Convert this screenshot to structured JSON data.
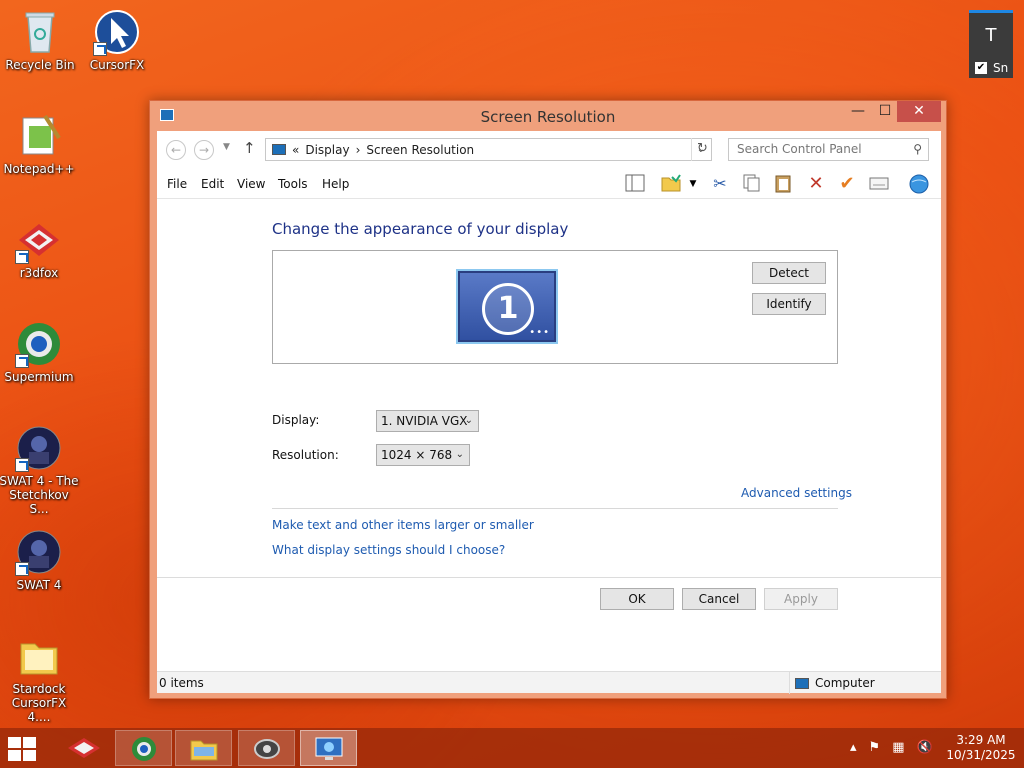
{
  "desktop": {
    "icons": [
      {
        "label": "Recycle Bin"
      },
      {
        "label": "CursorFX"
      },
      {
        "label": "Notepad++"
      },
      {
        "label": "r3dfox"
      },
      {
        "label": "Supermium"
      },
      {
        "label": "SWAT 4 - The Stetchkov S..."
      },
      {
        "label": "SWAT 4"
      },
      {
        "label": "Stardock CursorFX 4...."
      }
    ]
  },
  "gadget": {
    "title": "T",
    "checkbox_label": "Sn",
    "checkbox_mark": "✔"
  },
  "window": {
    "title": "Screen Resolution",
    "controls": {
      "minimize": "—",
      "maximize": "☐",
      "close": "✕"
    },
    "address": {
      "breadcrumb": [
        "«",
        "Display",
        "›",
        "Screen Resolution"
      ],
      "search_placeholder": "Search Control Panel"
    },
    "menu": [
      "File",
      "Edit",
      "View",
      "Tools",
      "Help"
    ],
    "content": {
      "heading": "Change the appearance of your display",
      "monitor_number": "1",
      "detect": "Detect",
      "identify": "Identify",
      "display_label": "Display:",
      "display_value": "1. NVIDIA VGX",
      "resolution_label": "Resolution:",
      "resolution_value": "1024 × 768",
      "advanced_link": "Advanced settings",
      "link_text_size": "Make text and other items larger or smaller",
      "link_choose": "What display settings should I choose?",
      "ok": "OK",
      "cancel": "Cancel",
      "apply": "Apply"
    },
    "status": {
      "count": "0 items",
      "zone": "Computer"
    }
  },
  "taskbar": {
    "clock_time": "3:29 AM",
    "clock_date": "10/31/2025"
  }
}
